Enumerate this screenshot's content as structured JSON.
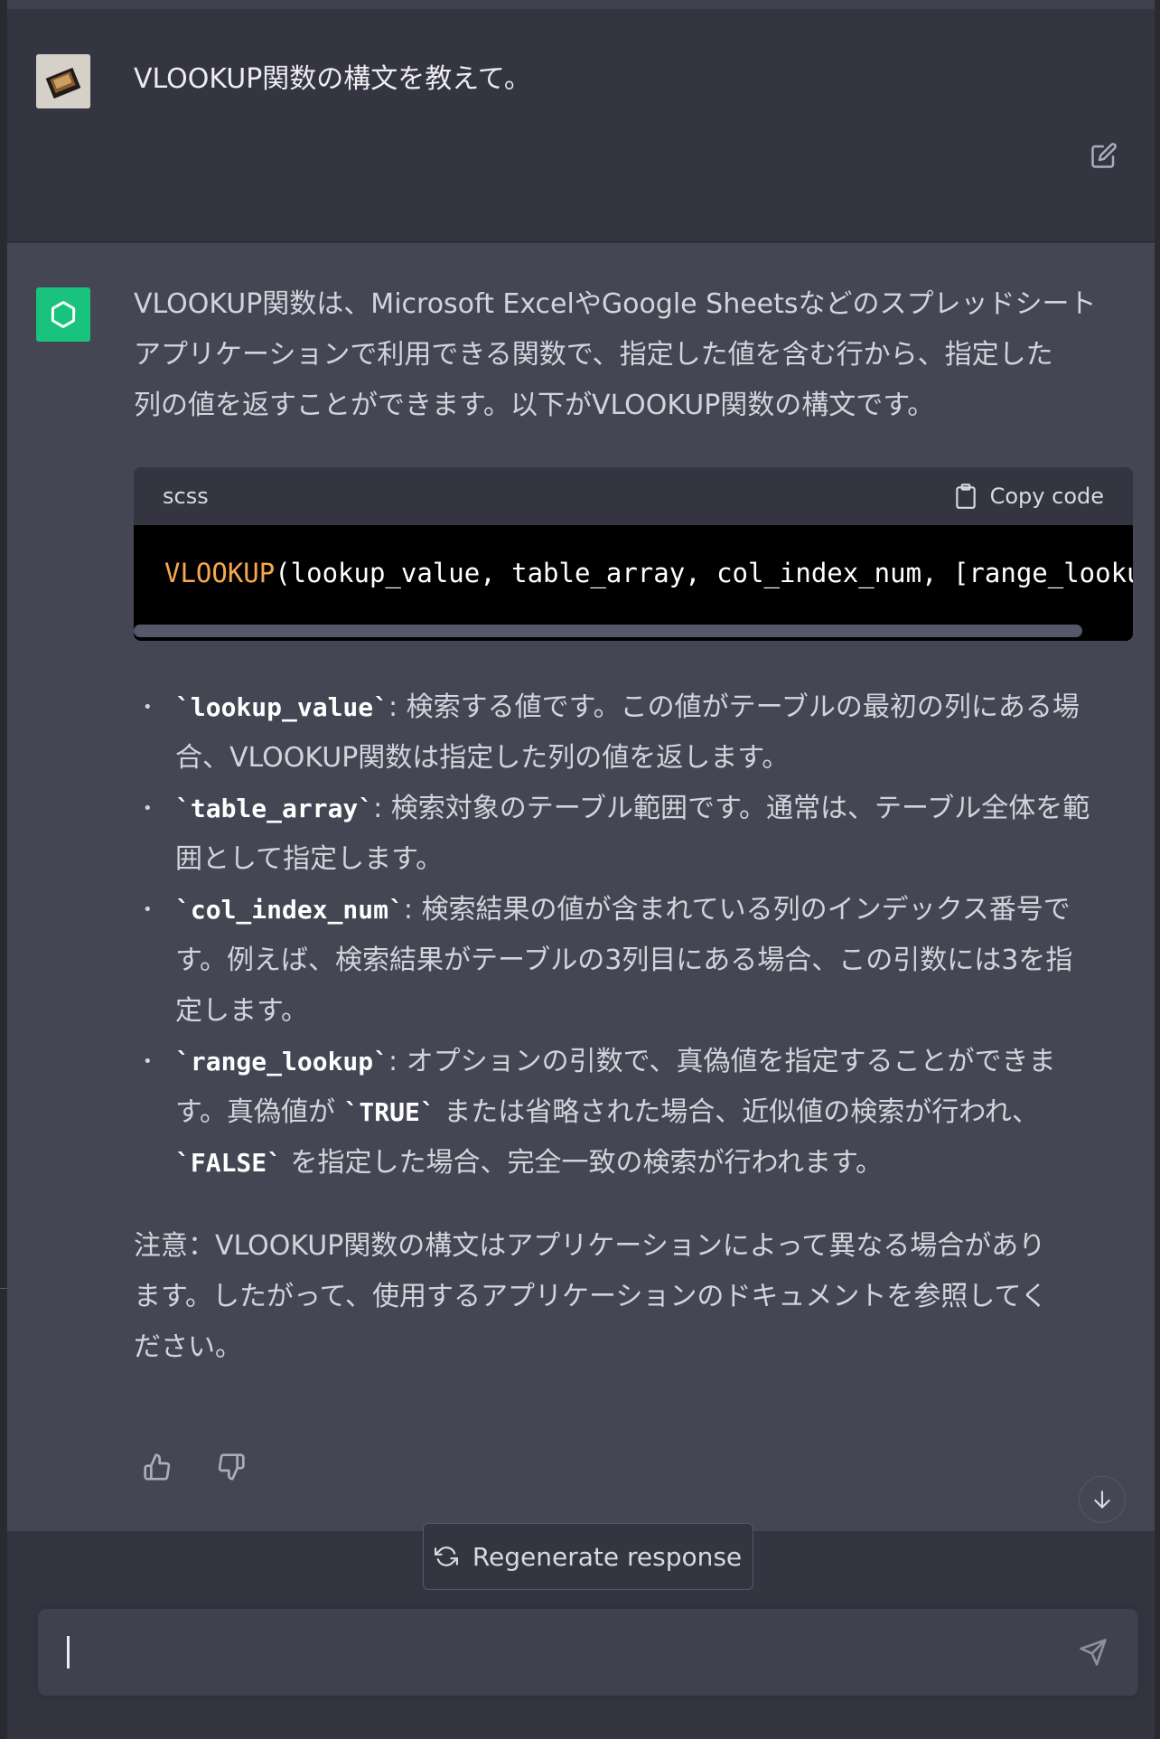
{
  "user_message": {
    "text": "VLOOKUP関数の構文を教えて。"
  },
  "assistant": {
    "intro_line_1": "VLOOKUP関数は、Microsoft ExcelやGoogle Sheetsなどのスプレッドシート",
    "intro_line_2": "アプリケーションで利用できる関数で、指定した値を含む行から、指定した",
    "intro_line_3": "列の値を返すことができます。以下がVLOOKUP関数の構文です。",
    "code": {
      "language": "scss",
      "copy_label": "Copy code",
      "fn_name": "VLOOKUP",
      "args": "(lookup_value, table_array, col_index_num, [range_lookup])"
    },
    "bullets": [
      {
        "code": "`lookup_value`",
        "line_1": ": 検索する値です。この値がテーブルの最初の列にある場",
        "line_2": "合、VLOOKUP関数は指定した列の値を返します。"
      },
      {
        "code": "`table_array`",
        "line_1": ": 検索対象のテーブル範囲です。通常は、テーブル全体を範",
        "line_2": "囲として指定します。"
      },
      {
        "code": "`col_index_num`",
        "line_1": ": 検索結果の値が含まれている列のインデックス番号で",
        "line_2": "す。例えば、検索結果がテーブルの3列目にある場合、この引数には3を指",
        "line_3": "定します。"
      },
      {
        "code": "`range_lookup`",
        "line_1": ": オプションの引数で、真偽値を指定することができま",
        "line_2a": "す。真偽値が ",
        "true_code": "`TRUE`",
        "line_2b": " または省略された場合、近似値の検索が行われ、",
        "false_code": "`FALSE`",
        "line_3": " を指定した場合、完全一致の検索が行われます。"
      }
    ],
    "note_line_1": "注意：VLOOKUP関数の構文はアプリケーションによって異なる場合があり",
    "note_line_2": "ます。したがって、使用するアプリケーションのドキュメントを参照してく",
    "note_line_3": "ださい。"
  },
  "controls": {
    "regenerate_label": "Regenerate response",
    "input_value": ""
  },
  "icons": {
    "edit": "edit-icon",
    "copy": "clipboard-icon",
    "thumbs_up": "thumbs-up-icon",
    "thumbs_down": "thumbs-down-icon",
    "scroll_down": "arrow-down-icon",
    "regenerate": "refresh-icon",
    "send": "send-icon"
  },
  "colors": {
    "background": "#343541",
    "assistant_background": "#444654",
    "bot_avatar": "#19c37d",
    "code_function": "#f7a84b"
  }
}
